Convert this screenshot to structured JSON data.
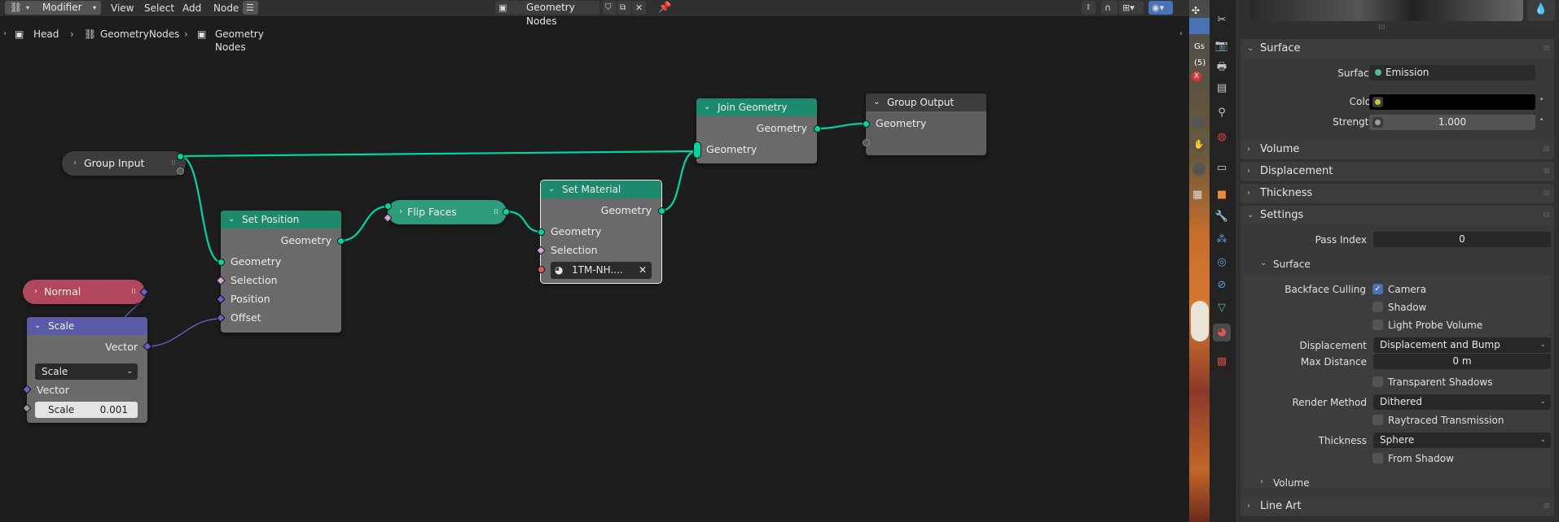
{
  "topbar": {
    "editor_type": "Modifier",
    "menus": [
      "View",
      "Select",
      "Add",
      "Node"
    ],
    "node_group": "Geometry Nodes"
  },
  "breadcrumb": {
    "object": "Head",
    "modifier": "GeometryNodes",
    "node_group": "Geometry Nodes"
  },
  "nodes": {
    "group_input": {
      "title": "Group Input"
    },
    "normal": {
      "title": "Normal"
    },
    "scale": {
      "title": "Scale",
      "out_vector": "Vector",
      "mode": "Scale",
      "in_vector": "Vector",
      "scale_label": "Scale",
      "scale_value": "0.001"
    },
    "set_position": {
      "title": "Set Position",
      "out_geometry": "Geometry",
      "in_geometry": "Geometry",
      "selection": "Selection",
      "position": "Position",
      "offset": "Offset"
    },
    "flip_faces": {
      "title": "Flip Faces"
    },
    "set_material": {
      "title": "Set Material",
      "out_geometry": "Geometry",
      "in_geometry": "Geometry",
      "selection": "Selection",
      "material": "1TM-NH...."
    },
    "join_geometry": {
      "title": "Join Geometry",
      "out_geometry": "Geometry",
      "in_geometry": "Geometry"
    },
    "group_output": {
      "title": "Group Output",
      "in_geometry": "Geometry"
    }
  },
  "viewport": {
    "label_1": "Gs",
    "label_2": "(5)"
  },
  "properties": {
    "surface_section": "Surface",
    "surface_label": "Surface",
    "surface_value": "Emission",
    "color_label": "Color",
    "strength_label": "Strength",
    "strength_value": "1.000",
    "volume_section": "Volume",
    "displacement_section": "Displacement",
    "thickness_section": "Thickness",
    "settings_section": "Settings",
    "pass_index_label": "Pass Index",
    "pass_index_value": "0",
    "surface_sub": "Surface",
    "backface_label": "Backface Culling",
    "camera": "Camera",
    "shadow": "Shadow",
    "light_probe": "Light Probe Volume",
    "displacement_label": "Displacement",
    "displacement_value": "Displacement and Bump",
    "max_distance_label": "Max Distance",
    "max_distance_value": "0 m",
    "transparent_shadows": "Transparent Shadows",
    "render_method_label": "Render Method",
    "render_method_value": "Dithered",
    "raytraced": "Raytraced Transmission",
    "thickness_label": "Thickness",
    "thickness_value": "Sphere",
    "from_shadow": "From Shadow",
    "volume_sub": "Volume",
    "line_art_section": "Line Art"
  },
  "colors": {
    "geometry_header": "#1d8a6d",
    "normal_node": "#b0475a",
    "scale_header": "#5a5aa6",
    "socket_geometry": "#00d6a3",
    "socket_vector": "#6363c7",
    "accent_checkbox": "#4772b3"
  }
}
